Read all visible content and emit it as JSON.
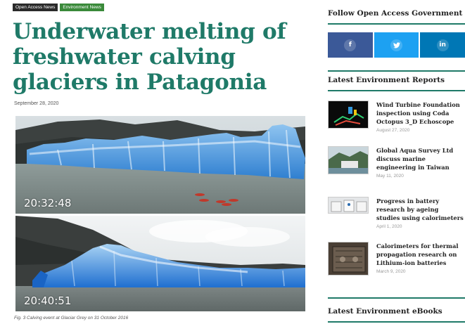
{
  "article": {
    "tags": [
      "Open Access News",
      "Environment News"
    ],
    "headline": "Underwater melting of freshwater calving glaciers in Patagonia",
    "date": "September 28, 2020",
    "photo_top_time": "20:32:48",
    "photo_bottom_time": "20:40:51",
    "caption": "Fig. 3 Calving event at Glaciar Grey on 31 October 2016"
  },
  "sidebar": {
    "follow_title": "Follow Open Access Government",
    "social": [
      {
        "label": "f",
        "icon": "facebook-icon",
        "color": "#3b5998"
      },
      {
        "label": "t",
        "icon": "twitter-icon",
        "color": "#1da1f2"
      },
      {
        "label": "in",
        "icon": "linkedin-icon",
        "color": "#0077b5"
      }
    ],
    "reports_title": "Latest Environment Reports",
    "reports": [
      {
        "title": "Wind Turbine Foundation inspection using Coda Octopus 3_D Echoscope",
        "date": "August 27, 2020"
      },
      {
        "title": "Global Aqua Survey Ltd discuss marine engineering in Taiwan",
        "date": "May 11, 2020"
      },
      {
        "title": "Progress in battery research by ageing studies using calorimeters",
        "date": "April 1, 2020"
      },
      {
        "title": "Calorimeters for thermal propagation research on Lithium-ion batteries",
        "date": "March 9, 2020"
      }
    ],
    "ebooks_title": "Latest Environment eBooks"
  },
  "colors": {
    "accent": "#1f7a68",
    "tag_dark": "#2a2a2a",
    "tag_green": "#3a8a3a"
  }
}
